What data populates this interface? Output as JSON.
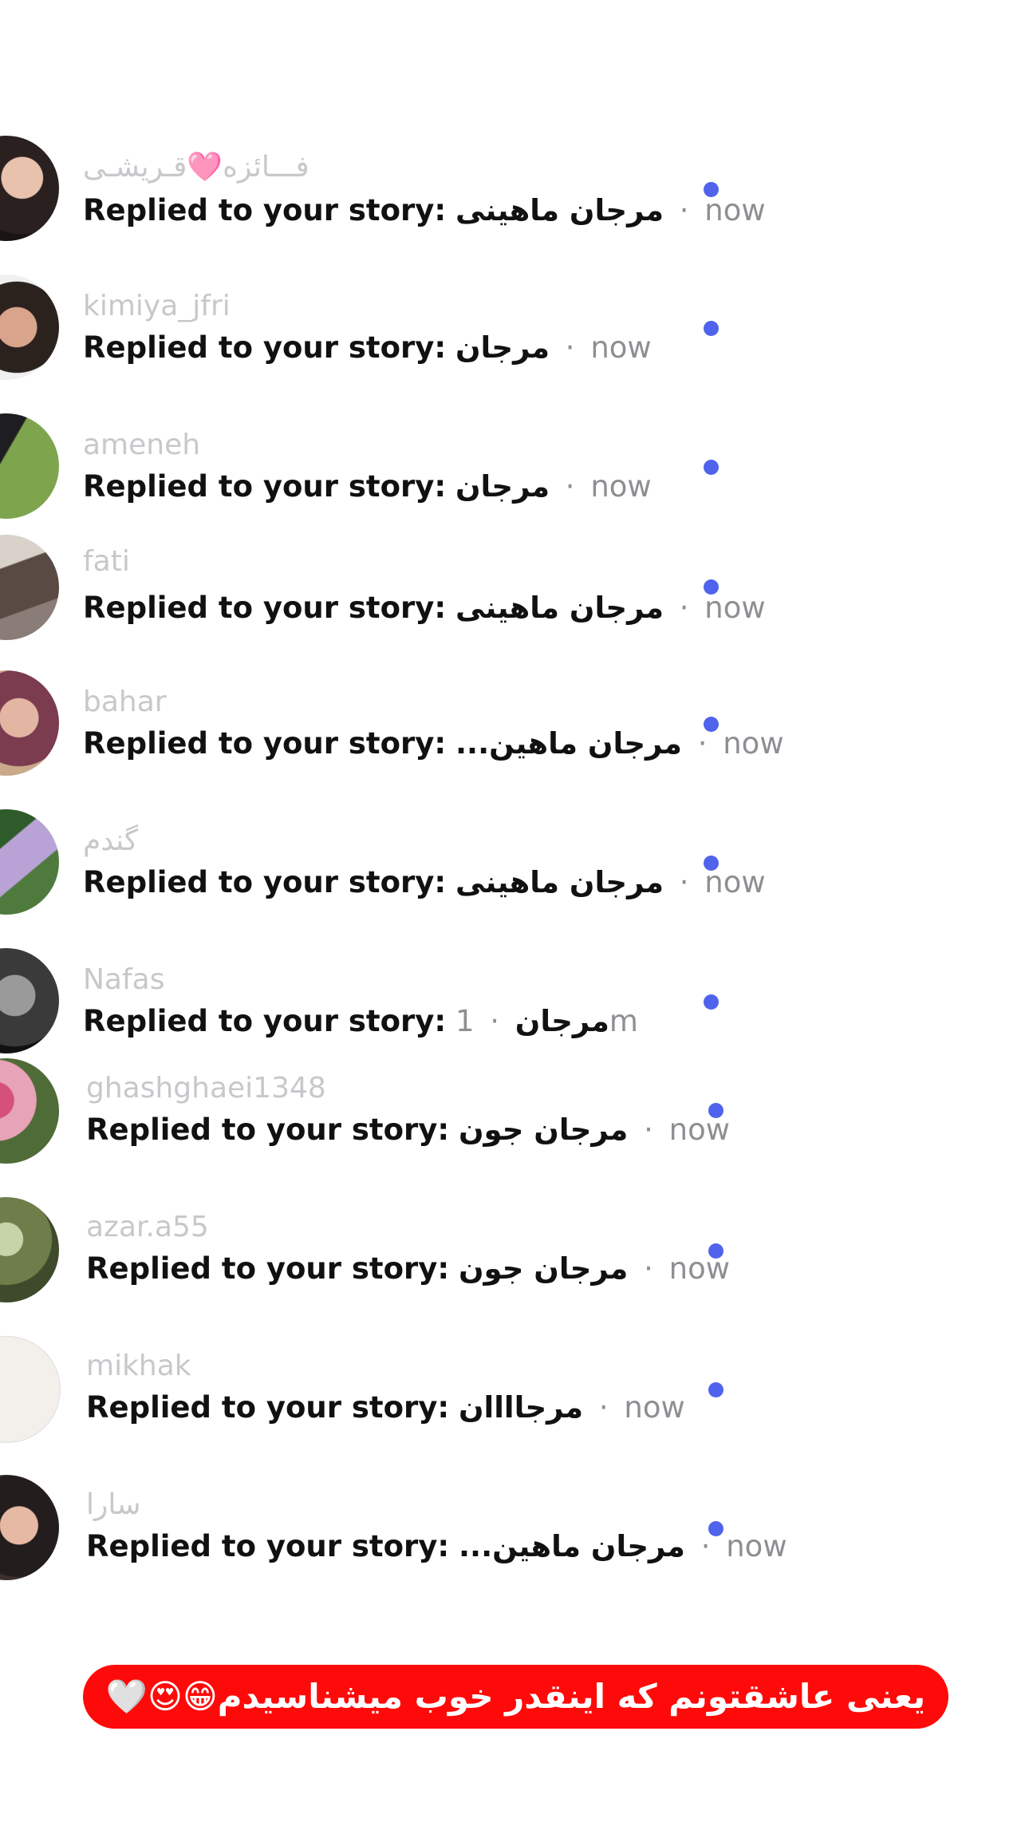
{
  "colors": {
    "unread_dot": "#4f63ec",
    "username": "#c8c8cc",
    "message": "#111111",
    "timestamp": "#8e8e93",
    "banner_bg": "#ff0a0a",
    "banner_text": "#ffffff"
  },
  "separator": "·",
  "notifications": [
    {
      "username": "فـــائزه🩷قـریشـی",
      "prefix": "Replied to your story:",
      "reply": "مرجان ماهینی",
      "time": "now",
      "unread": true
    },
    {
      "username": "kimiya_jfri",
      "prefix": "Replied to your story:",
      "reply": "مرجان",
      "time": "now",
      "unread": true
    },
    {
      "username": "ameneh",
      "prefix": "Replied to your story:",
      "reply": "مرجان",
      "time": "now",
      "unread": true
    },
    {
      "username": "fati",
      "prefix": "Replied to your story:",
      "reply": "مرجان ماهینی",
      "time": "now",
      "unread": true
    },
    {
      "username": "bahar",
      "prefix": "Replied to your story:",
      "reply": "...مرجان ماهین",
      "time": "now",
      "unread": true
    },
    {
      "username": "گندم",
      "prefix": "Replied to your story:",
      "reply": "مرجان ماهینی",
      "time": "now",
      "unread": true
    },
    {
      "username": "Nafas",
      "prefix": "Replied to your story:",
      "reply": "مرجان",
      "time": "1m",
      "unread": true
    },
    {
      "username": "ghashghaei1348",
      "prefix": "Replied to your story:",
      "reply": "مرجان جون",
      "time": "now",
      "unread": true
    },
    {
      "username": "azar.a55",
      "prefix": "Replied to your story:",
      "reply": "مرجان جون",
      "time": "now",
      "unread": true
    },
    {
      "username": "mikhak",
      "prefix": "Replied to your story:",
      "reply": "مرجاااان",
      "time": "now",
      "unread": true
    },
    {
      "username": "سارا",
      "prefix": "Replied to your story:",
      "reply": "...مرجان ماهین",
      "time": "now",
      "unread": true
    }
  ],
  "banner": {
    "text": "یعنی عاشقتونم که اینقدر خوب میشناسیدم😁😍🤍"
  }
}
